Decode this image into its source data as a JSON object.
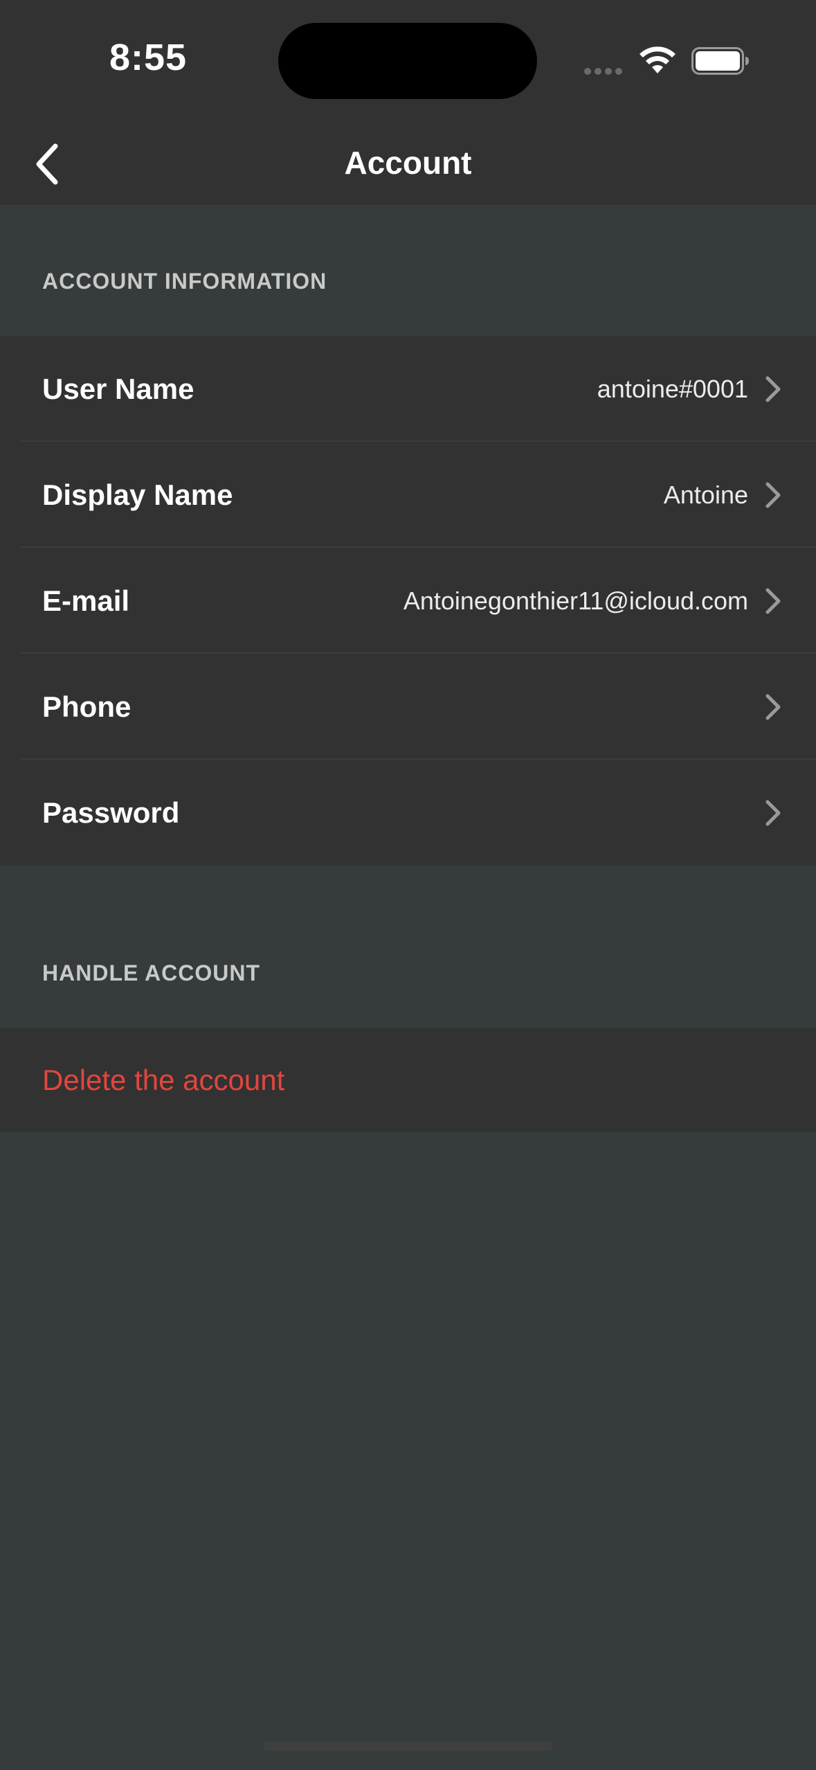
{
  "status_bar": {
    "time": "8:55"
  },
  "nav": {
    "title": "Account",
    "back_icon": "chevron-left-icon"
  },
  "sections": {
    "account_information": {
      "header": "ACCOUNT INFORMATION",
      "rows": [
        {
          "label": "User Name",
          "value": "antoine#0001"
        },
        {
          "label": "Display Name",
          "value": "Antoine"
        },
        {
          "label": "E-mail",
          "value": "Antoinegonthier11@icloud.com"
        },
        {
          "label": "Phone",
          "value": ""
        },
        {
          "label": "Password",
          "value": ""
        }
      ]
    },
    "handle_account": {
      "header": "HANDLE ACCOUNT",
      "delete_label": "Delete the account"
    }
  },
  "colors": {
    "background": "#363b3b",
    "cell": "#323232",
    "destructive": "#e2463d"
  }
}
